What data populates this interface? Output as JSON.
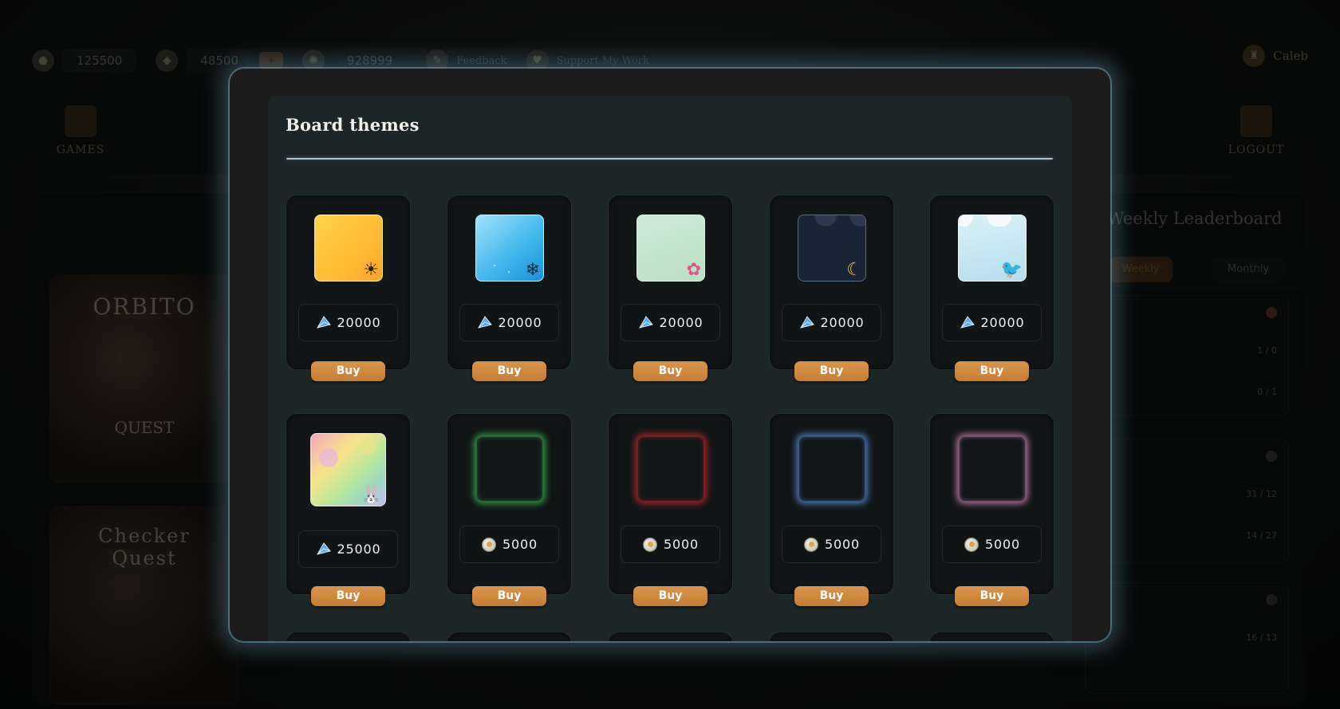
{
  "topbar": {
    "coins": "125500",
    "diamonds": "48500",
    "gems": "928999",
    "feedback_label": "Feedback",
    "support_label": "Support My Work",
    "plus_label": "+",
    "user_name": "Caleb"
  },
  "nav": {
    "games_label": "GAMES",
    "logout_label": "LOGOUT"
  },
  "games": {
    "game1_title": "ORBITO",
    "game1_sub": "QUEST",
    "game2_title": "Checker Quest"
  },
  "leaderboard": {
    "title": "Weekly Leaderboard",
    "tab_weekly": "Weekly",
    "tab_monthly": "Monthly",
    "rows": [
      "1 / 0",
      "0 / 1",
      "31 / 12",
      "14 / 27",
      "16 / 13"
    ]
  },
  "modal": {
    "title": "Board themes",
    "buy_label": "Buy",
    "themes": [
      {
        "price": "20000",
        "currency": "diamond",
        "swatch": "sunny",
        "glyph": "sun-icon",
        "glyph_char": "☀"
      },
      {
        "price": "20000",
        "currency": "diamond",
        "swatch": "ice-blue",
        "glyph": "snowflake-icon",
        "glyph_char": "❄"
      },
      {
        "price": "20000",
        "currency": "diamond",
        "swatch": "mint",
        "glyph": "flower-icon",
        "glyph_char": "✿"
      },
      {
        "price": "20000",
        "currency": "diamond",
        "swatch": "night",
        "glyph": "moon-icon",
        "glyph_char": "☾"
      },
      {
        "price": "20000",
        "currency": "diamond",
        "swatch": "winter",
        "glyph": "cardinal-icon",
        "glyph_char": "🐦"
      },
      {
        "price": "25000",
        "currency": "diamond",
        "swatch": "spring",
        "glyph": "bunny-icon",
        "glyph_char": "🐰"
      },
      {
        "price": "5000",
        "currency": "coin",
        "swatch": "neon-green"
      },
      {
        "price": "5000",
        "currency": "coin",
        "swatch": "neon-red"
      },
      {
        "price": "5000",
        "currency": "coin",
        "swatch": "neon-blue"
      },
      {
        "price": "5000",
        "currency": "coin",
        "swatch": "neon-pink"
      }
    ],
    "row3_swatches": [
      "neon-purple",
      "neon-rose",
      "neon-yellow",
      "neon-violet",
      "neon-emerald"
    ]
  },
  "colors": {
    "buy_button": "#d08a3f",
    "modal_glow": "#8ccbe4",
    "divider": "#a9c8d6"
  }
}
